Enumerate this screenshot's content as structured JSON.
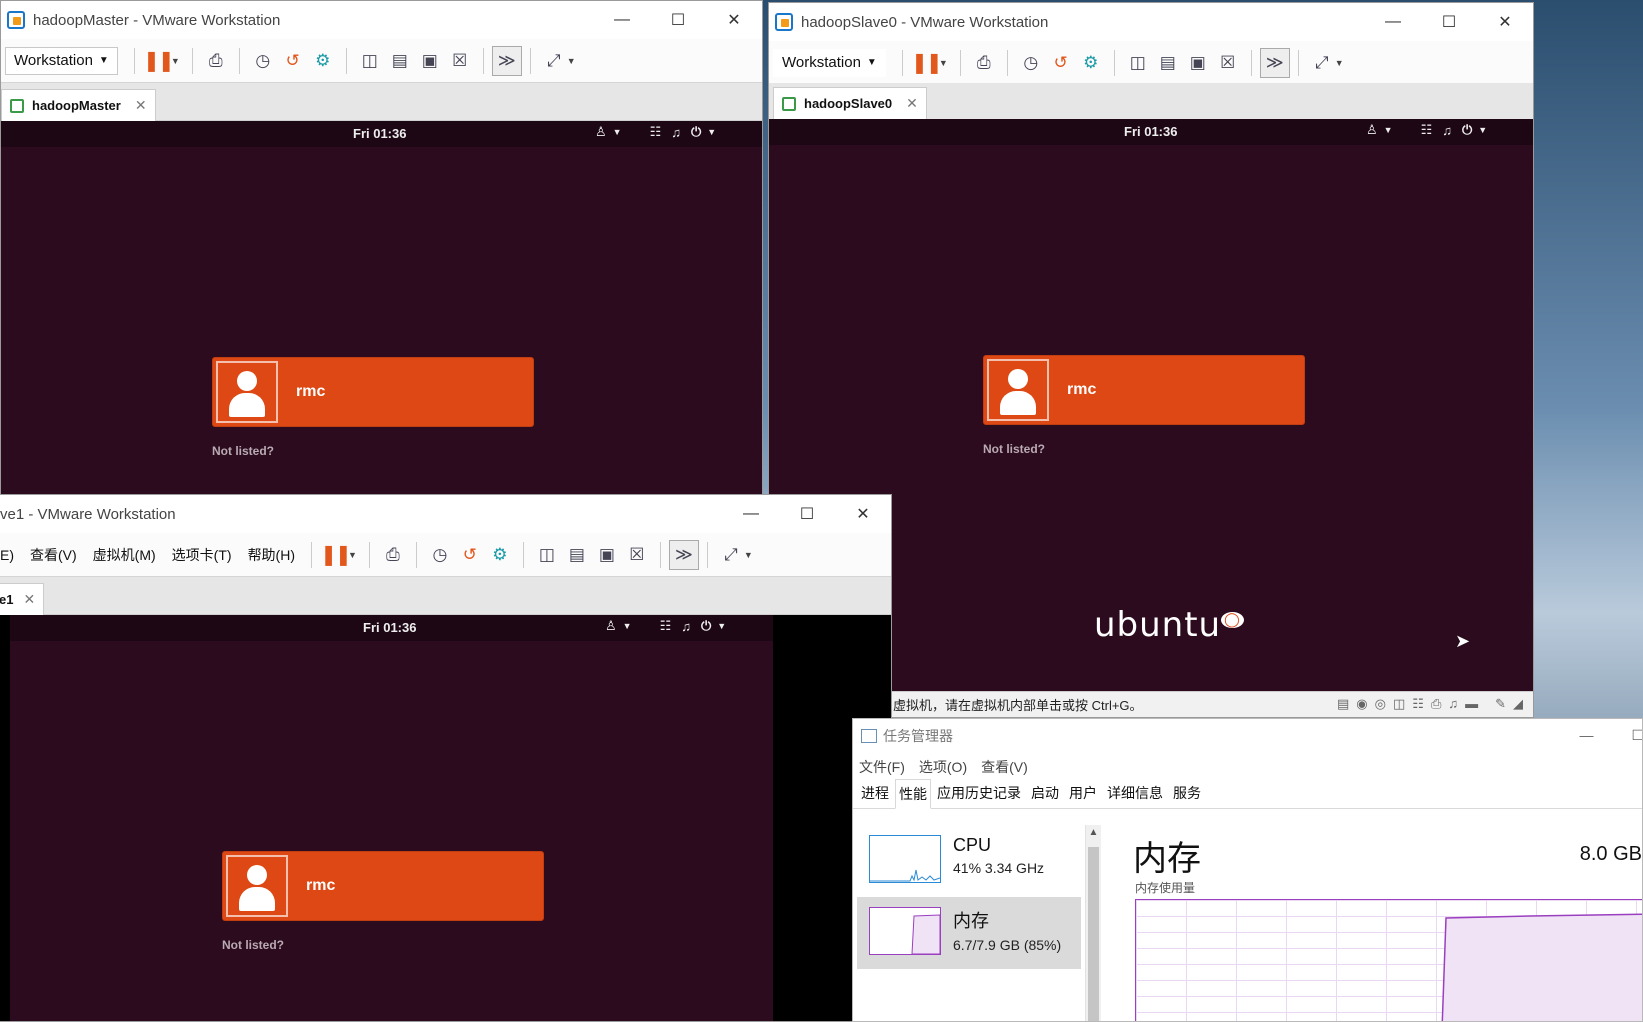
{
  "master": {
    "title": "hadoopMaster - VMware Workstation",
    "workstation_label": "Workstation",
    "tab_label": "hadoopMaster",
    "clock": "Fri 01:36",
    "user": "rmc",
    "not_listed": "Not listed?"
  },
  "slave0": {
    "title": "hadoopSlave0 - VMware Workstation",
    "workstation_label": "Workstation",
    "tab_label": "hadoopSlave0",
    "clock": "Fri 01:36",
    "user": "rmc",
    "not_listed": "Not listed?",
    "logo": "ubuntu",
    "status_text": "虚拟机，请在虚拟机内部单击或按 Ctrl+G。"
  },
  "slave1": {
    "title": "ve1 - VMware Workstation",
    "menu": [
      "E)",
      "查看(V)",
      "虚拟机(M)",
      "选项卡(T)",
      "帮助(H)"
    ],
    "tab_label": "e1",
    "clock": "Fri 01:36",
    "user": "rmc",
    "not_listed": "Not listed?"
  },
  "taskmanager": {
    "title": "任务管理器",
    "menu": [
      "文件(F)",
      "选项(O)",
      "查看(V)"
    ],
    "tabs": [
      "进程",
      "性能",
      "应用历史记录",
      "启动",
      "用户",
      "详细信息",
      "服务"
    ],
    "active_tab": "性能",
    "cpu": {
      "name": "CPU",
      "value": "41%  3.34 GHz"
    },
    "memory": {
      "name": "内存",
      "value": "6.7/7.9 GB (85%)"
    },
    "main_title": "内存",
    "total": "8.0 GB",
    "usage_label": "内存使用量"
  },
  "colors": {
    "ubuntu_orange": "#dd4814",
    "vm_background": "#2c0b1f",
    "cpu_graph": "#2a8ad6",
    "memory_graph": "#9a3fbf"
  }
}
